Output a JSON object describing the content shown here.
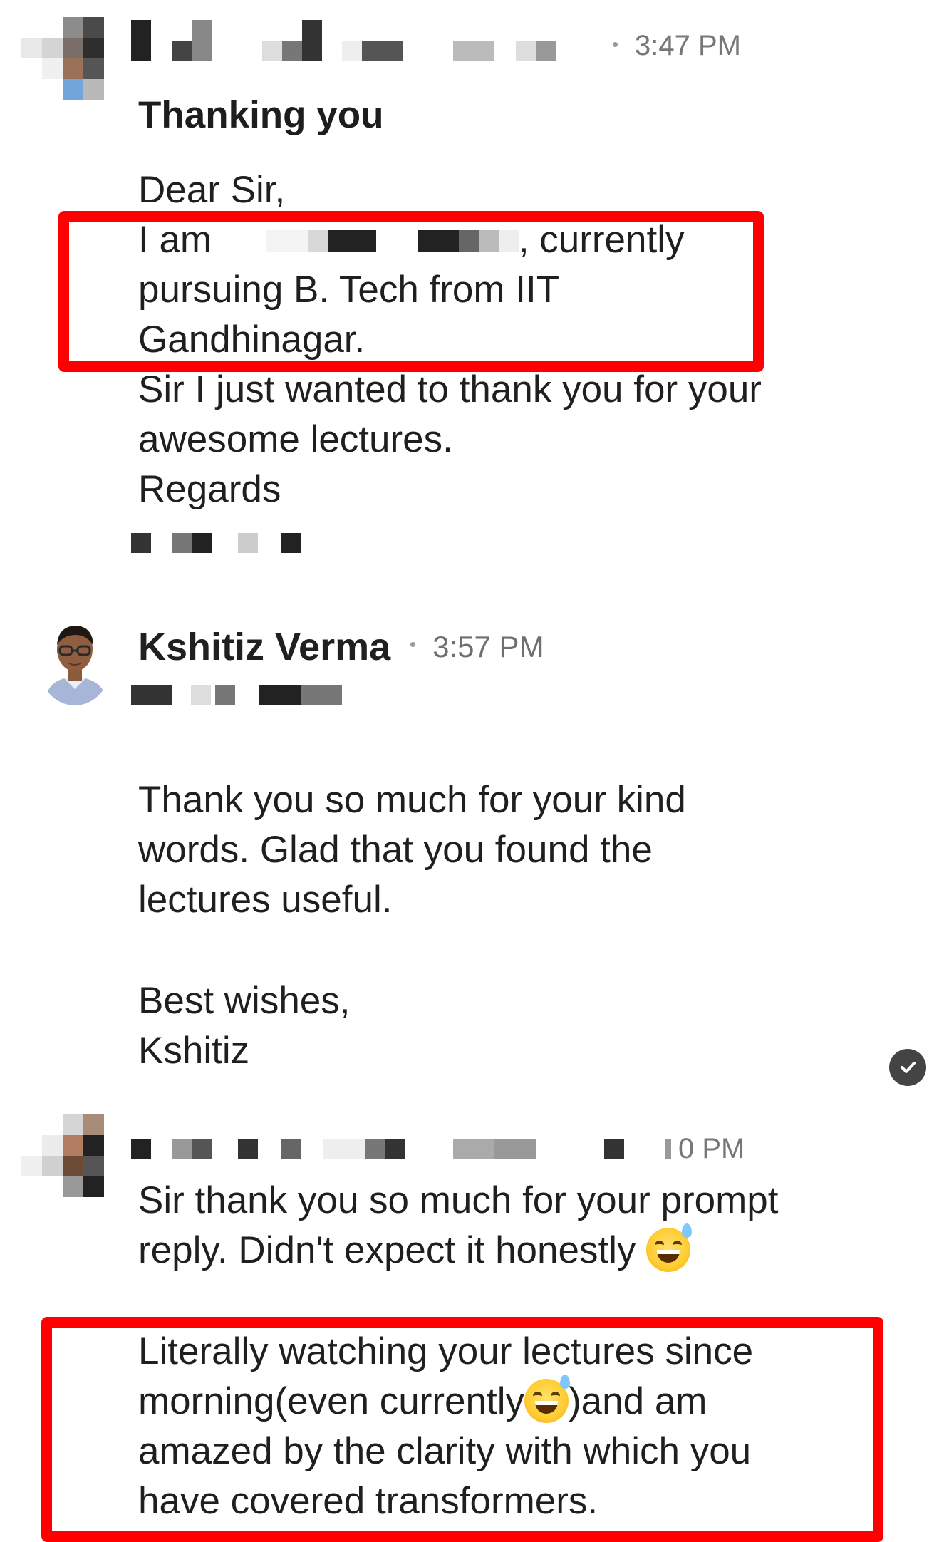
{
  "messages": [
    {
      "sender": "",
      "time": "3:47 PM",
      "subject": "Thanking you",
      "body_lines": [
        "Dear Sir,",
        ", currently",
        "pursuing B. Tech from IIT",
        "Gandhinagar.",
        "Sir I just wanted to thank you for your",
        "awesome lectures.",
        "Regards"
      ],
      "line2_prefix": "I am"
    },
    {
      "sender": "Kshitiz Verma",
      "time": "3:57 PM",
      "body_lines": [
        "Thank you so much for your kind",
        "words. Glad that you found the",
        "lectures useful.",
        "",
        "Best wishes,",
        "Kshitiz"
      ]
    },
    {
      "sender": "",
      "time": "0 PM",
      "body_lines": [
        "Sir thank you so much for your prompt",
        "reply. Didn't expect it honestly",
        "Literally watching your lectures since",
        "morning(even currently",
        ")and am",
        "amazed by the clarity with which you",
        "have covered transformers."
      ]
    }
  ],
  "icons": {
    "sent_check": "check-circle-icon",
    "emoji": "grinning-face-with-sweat-emoji"
  },
  "colors": {
    "highlight": "#ff0000",
    "text": "#1f1f1f",
    "timestamp": "#777777"
  }
}
